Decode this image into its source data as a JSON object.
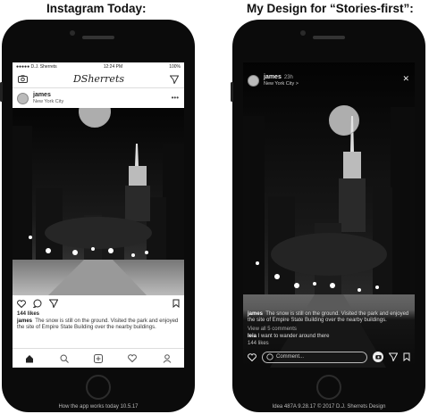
{
  "headings": {
    "left": "Instagram Today:",
    "right": "My Design for “Stories-first”:"
  },
  "left": {
    "status": {
      "carrier": "●●●●● D.J. Sherrets",
      "time": "12:24 PM",
      "battery": "100%"
    },
    "logo": "DSherrets",
    "post": {
      "username": "james",
      "location": "New York City",
      "more": "•••"
    },
    "likes": "144 likes",
    "caption_user": "james",
    "caption_text": "The snow is still on the ground. Visited the park and enjoyed the site of Empire State Building over the nearby buildings.",
    "footer": "How the app works today 10.5.17"
  },
  "right": {
    "post": {
      "username": "james",
      "time": "23h",
      "location": "New York City >"
    },
    "close": "✕",
    "caption_user": "james",
    "caption_text": "The snow is still on the ground. Visited the park and enjoyed the site of Empire State Building over the nearby buildings.",
    "view_all": "View all 5 comments",
    "comment_user": "leia",
    "comment_text": "I want to wander around there",
    "likes": "144 likes",
    "comment_placeholder": "Comment...",
    "footer": "Idea 487A   9.28.17   © 2017 D.J. Sherrets Design"
  },
  "colors": {
    "phone": "#0b0b0b",
    "photo_dark": "#111111",
    "highlight": "#e6e6e6"
  }
}
